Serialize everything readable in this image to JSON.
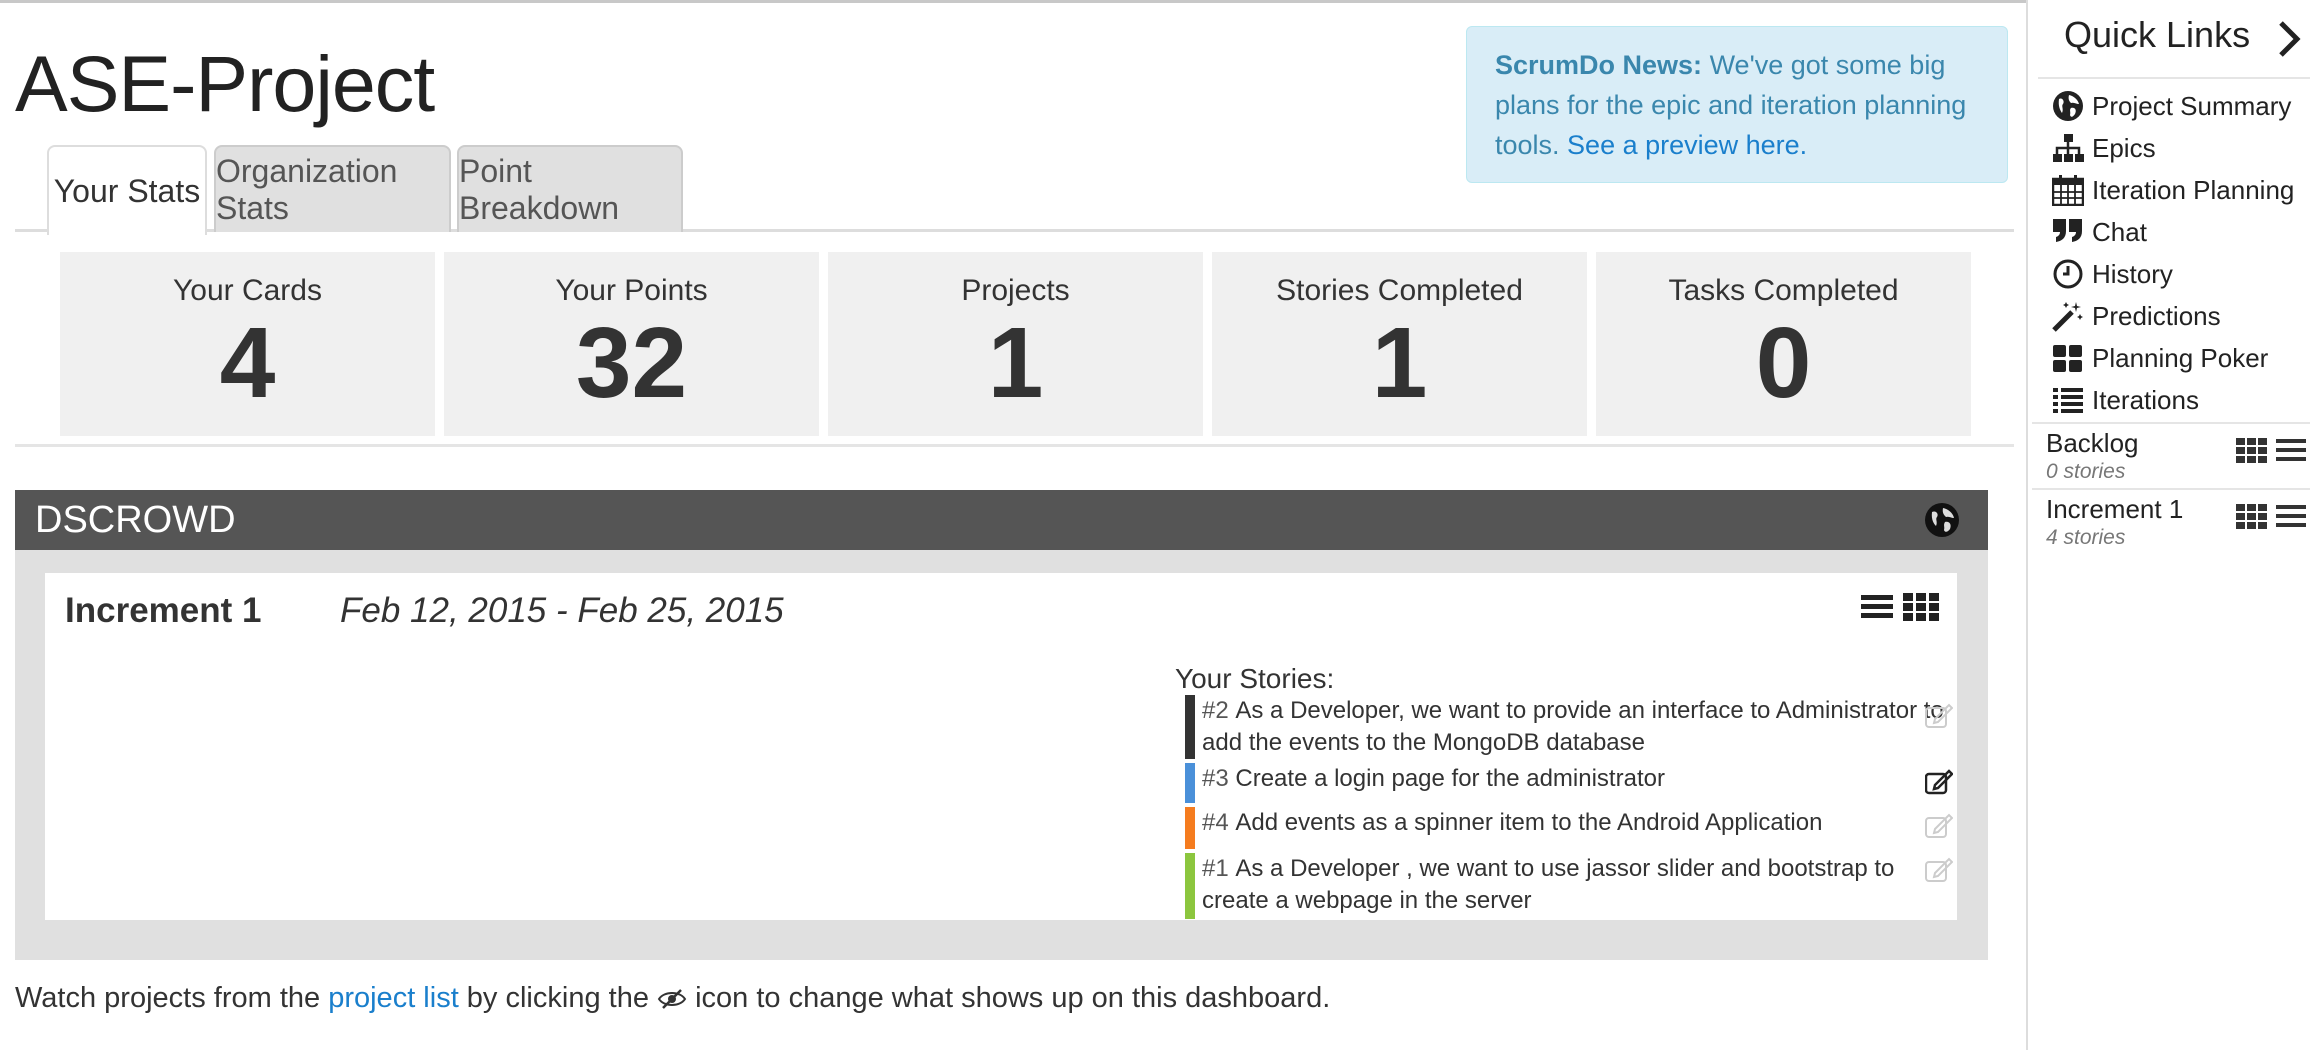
{
  "project_title": "ASE-Project",
  "news": {
    "label": "ScrumDo News:",
    "text": " We've got some big plans for the epic and iteration planning tools. ",
    "link": "See a preview here."
  },
  "tabs": [
    {
      "label": "Your Stats"
    },
    {
      "label": "Organization Stats"
    },
    {
      "label": "Point Breakdown"
    }
  ],
  "stats": [
    {
      "label": "Your Cards",
      "value": "4"
    },
    {
      "label": "Your Points",
      "value": "32"
    },
    {
      "label": "Projects",
      "value": "1"
    },
    {
      "label": "Stories Completed",
      "value": "1"
    },
    {
      "label": "Tasks Completed",
      "value": "0"
    }
  ],
  "project": {
    "name": "DSCROWD",
    "iteration": {
      "name": "Increment 1",
      "dates": "Feb 12, 2015 - Feb 25, 2015",
      "stories_title": "Your Stories:",
      "stories": [
        {
          "num": "#2",
          "text": "As a Developer, we want to provide an interface to Administrator to add the events to the MongoDB database",
          "color": "#333333"
        },
        {
          "num": "#3",
          "text": "Create a login page for the administrator",
          "color": "#4a90d9"
        },
        {
          "num": "#4",
          "text": "Add events as a spinner item to the Android Application",
          "color": "#f57c1f"
        },
        {
          "num": "#1",
          "text": "As a Developer , we want to use jassor slider and bootstrap to create a webpage in the server",
          "color": "#8cc63e"
        }
      ]
    }
  },
  "footer": {
    "prefix": "Watch projects from the ",
    "link": "project list",
    "middle": " by clicking the ",
    "suffix": " icon to change what shows up on this dashboard."
  },
  "sidebar": {
    "title": "Quick Links",
    "items": [
      {
        "label": "Project Summary",
        "icon": "globe-icon"
      },
      {
        "label": "Epics",
        "icon": "sitemap-icon"
      },
      {
        "label": "Iteration Planning",
        "icon": "calendar-icon"
      },
      {
        "label": "Chat",
        "icon": "quote-icon"
      },
      {
        "label": "History",
        "icon": "clock-icon"
      },
      {
        "label": "Predictions",
        "icon": "magic-wand-icon"
      },
      {
        "label": "Planning Poker",
        "icon": "cards-icon"
      },
      {
        "label": "Iterations",
        "icon": "list-icon"
      }
    ],
    "iterations": [
      {
        "name": "Backlog",
        "count": "0 stories"
      },
      {
        "name": "Increment 1",
        "count": "4 stories"
      }
    ]
  },
  "colors": {
    "header_bg": "#555555",
    "news_bg": "#d9edf7",
    "link": "#1a7fcc"
  }
}
